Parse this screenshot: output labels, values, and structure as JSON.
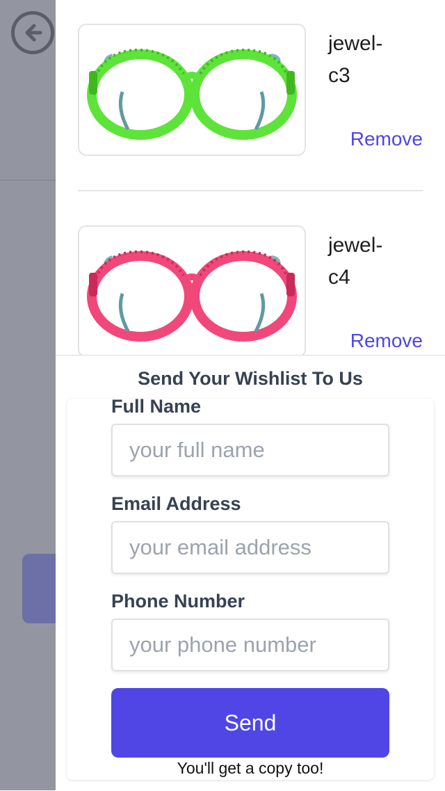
{
  "wishlist": {
    "items": [
      {
        "name": "jewel-c3",
        "remove_label": "Remove",
        "frame_color": "#5ee33a",
        "frame_dark": "#3fb81f"
      },
      {
        "name": "jewel-c4",
        "remove_label": "Remove",
        "frame_color": "#f0487a",
        "frame_dark": "#c92a5a"
      }
    ]
  },
  "form": {
    "title": "Send Your Wishlist To Us",
    "full_name_label": "Full Name",
    "full_name_placeholder": "your full name",
    "email_label": "Email Address",
    "email_placeholder": "your email address",
    "phone_label": "Phone Number",
    "phone_placeholder": "your phone number",
    "send_label": "Send",
    "note": "You'll get a copy too!"
  },
  "colors": {
    "accent": "#4f46e5",
    "overlay": "#9396a0"
  }
}
